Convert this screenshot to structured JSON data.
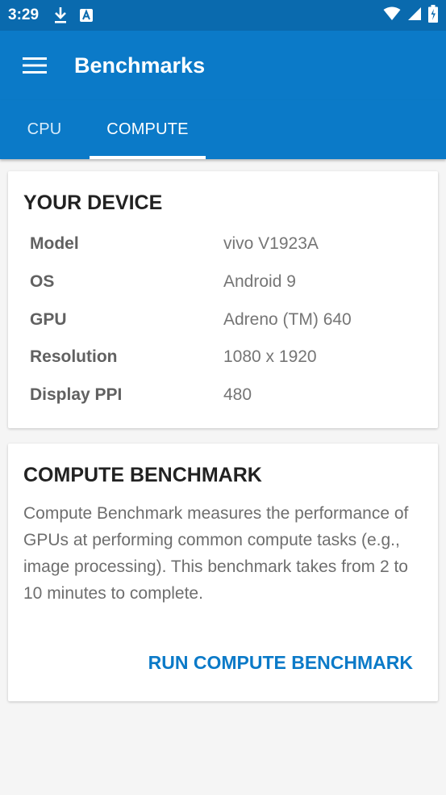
{
  "status_bar": {
    "time": "3:29",
    "icons_left": [
      "download-icon",
      "a-badge-icon"
    ],
    "icons_right": [
      "wifi-icon",
      "signal-icon",
      "battery-icon"
    ]
  },
  "app_bar": {
    "title": "Benchmarks",
    "menu_icon": "hamburger-menu-icon"
  },
  "tabs": [
    {
      "label": "CPU",
      "active": false
    },
    {
      "label": "COMPUTE",
      "active": true
    }
  ],
  "device_card": {
    "heading": "YOUR DEVICE",
    "specs": [
      {
        "label": "Model",
        "value": "vivo V1923A"
      },
      {
        "label": "OS",
        "value": "Android 9"
      },
      {
        "label": "GPU",
        "value": "Adreno (TM) 640"
      },
      {
        "label": "Resolution",
        "value": "1080 x 1920"
      },
      {
        "label": "Display PPI",
        "value": "480"
      }
    ]
  },
  "compute_card": {
    "heading": "COMPUTE BENCHMARK",
    "description": "Compute Benchmark measures the performance of GPUs at performing common compute tasks (e.g., image processing). This benchmark takes from 2 to 10 minutes to complete.",
    "button_label": "RUN COMPUTE BENCHMARK"
  },
  "colors": {
    "status_bar": "#0a6aae",
    "primary": "#0b7ac8",
    "background": "#f5f5f5"
  }
}
